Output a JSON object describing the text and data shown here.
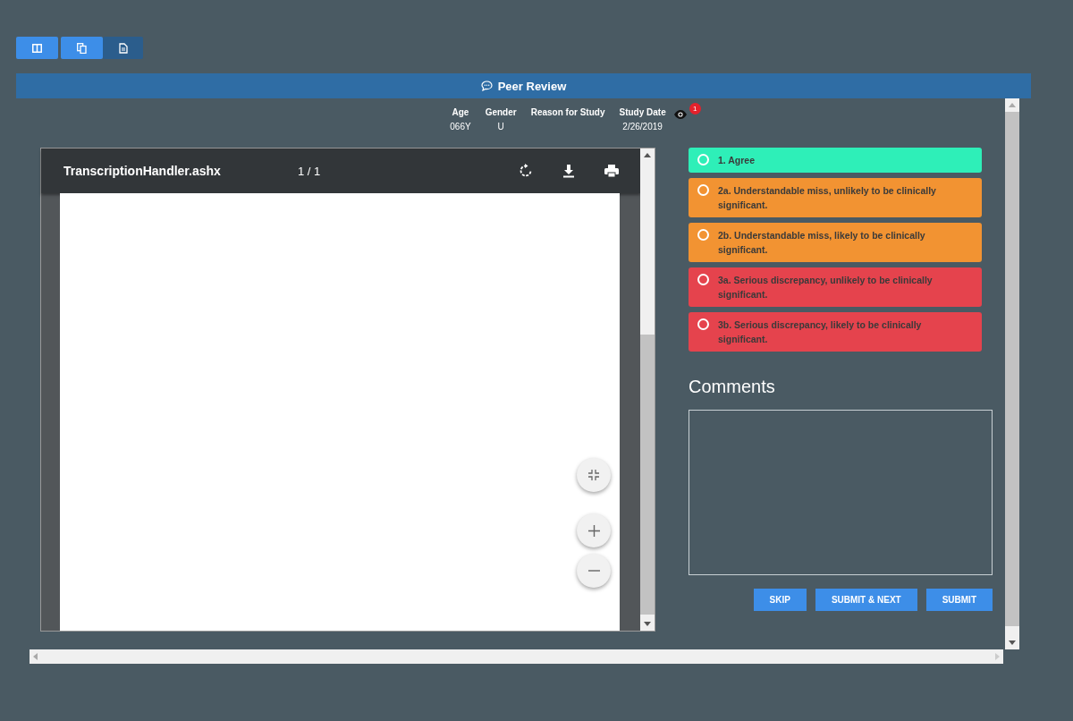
{
  "toolbar": [
    {
      "selected": false
    },
    {
      "selected": false
    },
    {
      "selected": true
    }
  ],
  "header": {
    "title": "Peer Review"
  },
  "study_info": {
    "fields": [
      {
        "label": "Age",
        "value": "066Y"
      },
      {
        "label": "Gender",
        "value": "U"
      },
      {
        "label": "Reason for Study"
      },
      {
        "label": "Study Date",
        "value": "2/26/2019"
      }
    ],
    "badge": "1"
  },
  "viewer": {
    "file_name": "TranscriptionHandler.ashx",
    "page": "1 / 1"
  },
  "options": [
    {
      "label": "1. Agree",
      "color": "#2eefb8",
      "selected": false
    },
    {
      "label": "2a. Understandable miss, unlikely to be clinically significant.",
      "color": "#f29332",
      "selected": false
    },
    {
      "label": "2b. Understandable miss, likely to be clinically significant.",
      "color": "#f29332",
      "selected": false
    },
    {
      "label": "3a. Serious discrepancy, unlikely to be clinically significant.",
      "color": "#e5434d",
      "selected": false
    },
    {
      "label": "3b. Serious discrepancy, likely to be clinically significant.",
      "color": "#e5434d",
      "selected": false
    }
  ],
  "comments": {
    "title": "Comments"
  },
  "buttons": [
    "SKIP",
    "SUBMIT & NEXT",
    "SUBMIT"
  ]
}
